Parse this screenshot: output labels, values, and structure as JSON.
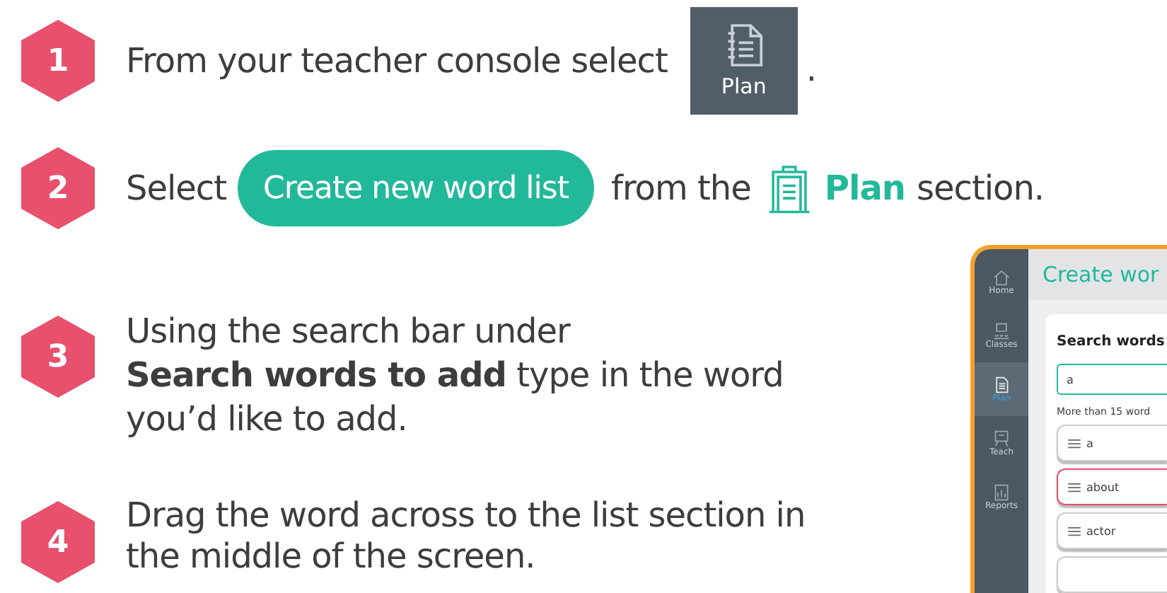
{
  "steps": [
    {
      "number": "1",
      "kind": "console",
      "text": "From your teacher console select",
      "button_label": "Plan",
      "trailing": "."
    },
    {
      "number": "2",
      "kind": "plan",
      "text": "Select",
      "button_label": "Create new word list",
      "middle": "from the",
      "section_name": "Plan",
      "trailing": "section."
    },
    {
      "number": "3",
      "kind": "text",
      "text": "Using the search bar under\n**Search words to add** type in the word you’d like to add."
    },
    {
      "number": "4",
      "kind": "text",
      "text": "Drag the word across to the list section in the middle of the screen."
    }
  ],
  "app_screenshot": {
    "title": "Create wor",
    "sidebar": [
      {
        "label": "Home",
        "kind": "home",
        "selected": false
      },
      {
        "label": "Classes",
        "kind": "classes",
        "selected": false
      },
      {
        "label": "Plan",
        "kind": "plan",
        "selected": true
      },
      {
        "label": "Teach",
        "kind": "teach",
        "selected": false
      },
      {
        "label": "Reports",
        "kind": "reports",
        "selected": false
      }
    ],
    "heading": "Search words",
    "search": {
      "value": "a"
    },
    "results_note": "More than 15 word",
    "words": [
      {
        "label": "a",
        "highlighted": false
      },
      {
        "label": "about",
        "highlighted": true
      },
      {
        "label": "actor",
        "highlighted": false
      }
    ]
  }
}
